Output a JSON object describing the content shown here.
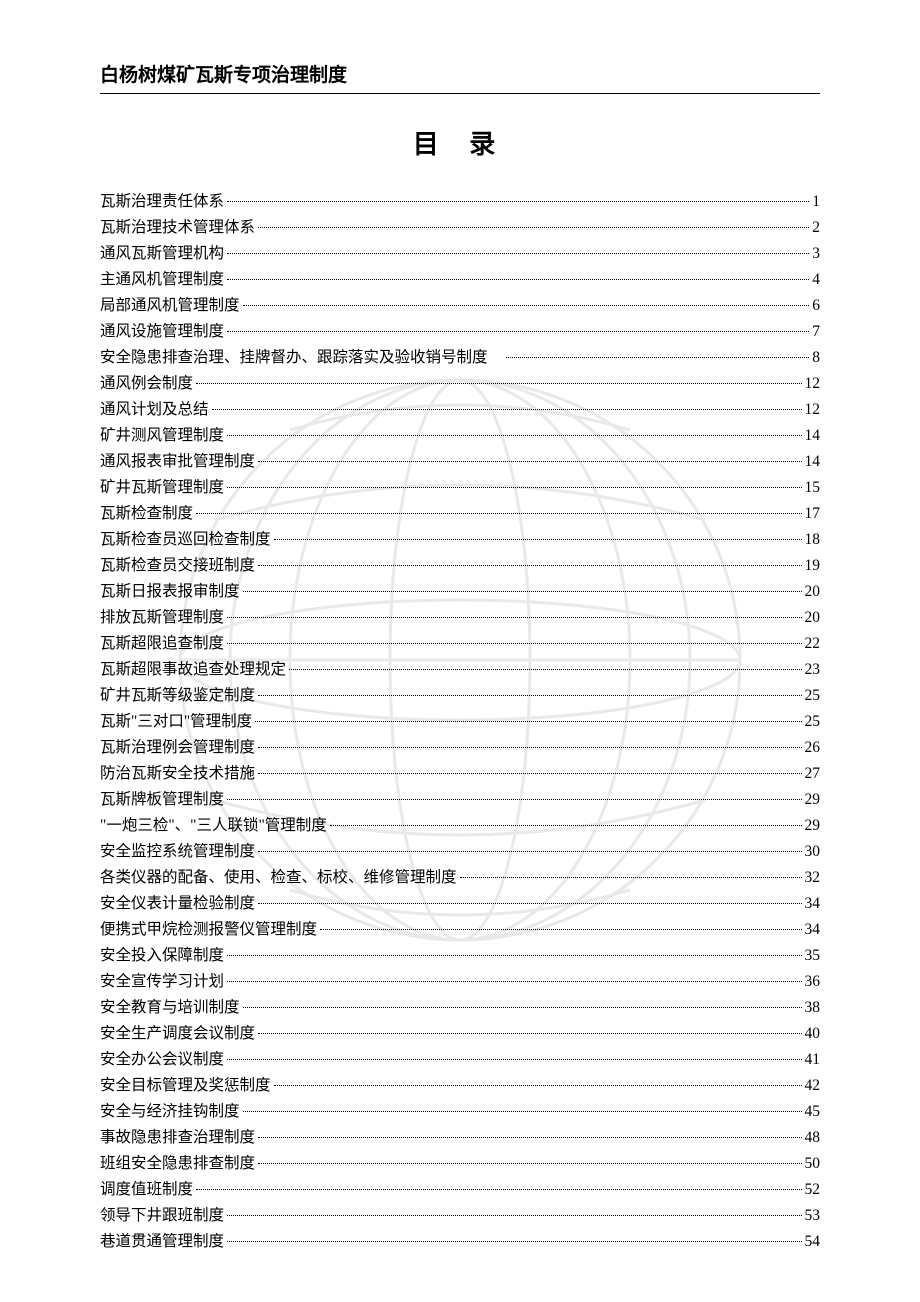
{
  "header": {
    "title": "白杨树煤矿瓦斯专项治理制度"
  },
  "toc": {
    "title": "目 录",
    "items": [
      {
        "label": "瓦斯治理责任体系",
        "page": "1"
      },
      {
        "label": "瓦斯治理技术管理体系",
        "page": "2"
      },
      {
        "label": "通风瓦斯管理机构",
        "page": "3"
      },
      {
        "label": "主通风机管理制度",
        "page": "4"
      },
      {
        "label": "局部通风机管理制度",
        "page": "6"
      },
      {
        "label": "通风设施管理制度",
        "page": "7"
      },
      {
        "label": "安全隐患排查治理、挂牌督办、跟踪落实及验收销号制度　",
        "page": "8"
      },
      {
        "label": "通风例会制度",
        "page": "12"
      },
      {
        "label": "通风计划及总结",
        "page": "12"
      },
      {
        "label": "矿井测风管理制度",
        "page": "14"
      },
      {
        "label": "通风报表审批管理制度",
        "page": "14"
      },
      {
        "label": "矿井瓦斯管理制度",
        "page": "15"
      },
      {
        "label": "瓦斯检查制度",
        "page": "17"
      },
      {
        "label": "瓦斯检查员巡回检查制度",
        "page": "18"
      },
      {
        "label": "瓦斯检查员交接班制度",
        "page": "19"
      },
      {
        "label": "瓦斯日报表报审制度",
        "page": "20"
      },
      {
        "label": "排放瓦斯管理制度",
        "page": "20"
      },
      {
        "label": "瓦斯超限追查制度",
        "page": "22"
      },
      {
        "label": "瓦斯超限事故追查处理规定",
        "page": "23"
      },
      {
        "label": "矿井瓦斯等级鉴定制度",
        "page": "25"
      },
      {
        "label": "瓦斯\"三对口\"管理制度",
        "page": "25"
      },
      {
        "label": "瓦斯治理例会管理制度",
        "page": "26"
      },
      {
        "label": "防治瓦斯安全技术措施",
        "page": "27"
      },
      {
        "label": "瓦斯牌板管理制度",
        "page": "29"
      },
      {
        "label": "\"一炮三检\"、\"三人联锁\"管理制度",
        "page": "29"
      },
      {
        "label": "安全监控系统管理制度",
        "page": "30"
      },
      {
        "label": "各类仪器的配备、使用、检查、标校、维修管理制度",
        "page": "32"
      },
      {
        "label": "安全仪表计量检验制度",
        "page": "34"
      },
      {
        "label": "便携式甲烷检测报警仪管理制度",
        "page": "34"
      },
      {
        "label": "安全投入保障制度",
        "page": "35"
      },
      {
        "label": "安全宣传学习计划",
        "page": "36"
      },
      {
        "label": "安全教育与培训制度",
        "page": "38"
      },
      {
        "label": "安全生产调度会议制度",
        "page": "40"
      },
      {
        "label": "安全办公会议制度",
        "page": "41"
      },
      {
        "label": "安全目标管理及奖惩制度",
        "page": "42"
      },
      {
        "label": "安全与经济挂钩制度",
        "page": "45"
      },
      {
        "label": "事故隐患排查治理制度",
        "page": "48"
      },
      {
        "label": "班组安全隐患排查制度",
        "page": "50"
      },
      {
        "label": "调度值班制度",
        "page": "52"
      },
      {
        "label": "领导下井跟班制度",
        "page": "53"
      },
      {
        "label": "巷道贯通管理制度",
        "page": "54"
      }
    ]
  }
}
